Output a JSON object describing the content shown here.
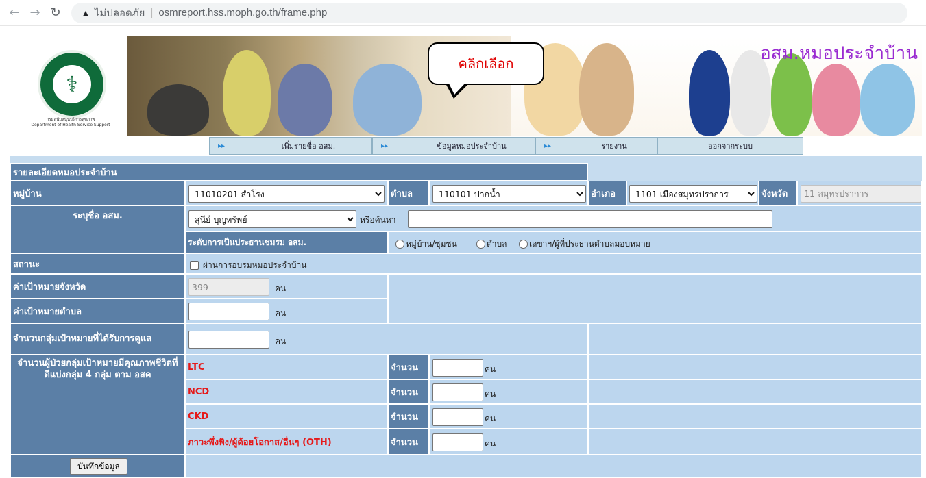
{
  "browser": {
    "security_label": "ไม่ปลอดภัย",
    "url": "osmreport.hss.moph.go.th/frame.php"
  },
  "banner": {
    "site_title": "อสม.หมอประจำบ้าน",
    "callout": "คลิกเลือก",
    "logo_caption_1": "กรมสนับสนุนบริการสุขภาพ",
    "logo_caption_2": "Department of Health Service Support",
    "logo_ring_text": "MINISTRY OF PUBLIC HEALTH"
  },
  "menu": [
    {
      "label": "เพิ่มรายชื่อ อสม."
    },
    {
      "label": "ข้อมูลหมอประจำบ้าน"
    },
    {
      "label": "รายงาน"
    },
    {
      "label": "ออกจากระบบ"
    }
  ],
  "form": {
    "section_title": "รายละเอียดหมอประจำบ้าน",
    "village_label": "หมู่บ้าน",
    "village_value": "11010201 สำโรง",
    "tambon_label": "ตำบล",
    "tambon_value": "110101 ปากน้ำ",
    "amphoe_label": "อำเภอ",
    "amphoe_value": "1101 เมืองสมุทรปราการ",
    "province_label": "จังหวัด",
    "province_value": "11-สมุทรปราการ",
    "osm_name_label": "ระบุชื่อ อสม.",
    "osm_name_value": "สุนีย์ บุญทรัพย์",
    "or_search_label": "หรือค้นหา",
    "search_value": "",
    "club_level_label": "ระดับการเป็นประธานชมรม อสม.",
    "radio_options": [
      "หมู่บ้าน/ชุมชน",
      "ตำบล",
      "เลขาฯ/ผู้ที่ประธานตำบลมอบหมาย"
    ],
    "status_label": "สถานะ",
    "trained_label": "ผ่านการอบรมหมอประจำบ้าน",
    "province_target_label": "ค่าเป้าหมายจังหวัด",
    "province_target_value": "399",
    "tambon_target_label": "ค่าเป้าหมายตำบล",
    "tambon_target_value": "",
    "cared_label": "จำนวนกลุ่มเป้าหมายที่ได้รับการดูแล",
    "cared_value": "",
    "unit": "คน",
    "quality_label": "จำนวนผู้ป่วยกลุ่มเป้าหมายมีคุณภาพชีวิตที่ดีแบ่งกลุ่ม 4 กลุ่ม ตาม อสค",
    "count_label": "จำนวน",
    "groups": [
      {
        "name": "LTC",
        "value": ""
      },
      {
        "name": "NCD",
        "value": ""
      },
      {
        "name": "CKD",
        "value": ""
      },
      {
        "name": "ภาวะพึ่งพิง/ผู้ด้อยโอกาส/อื่นๆ (OTH)",
        "value": ""
      }
    ],
    "save_button": "บันทึกข้อมูล"
  }
}
